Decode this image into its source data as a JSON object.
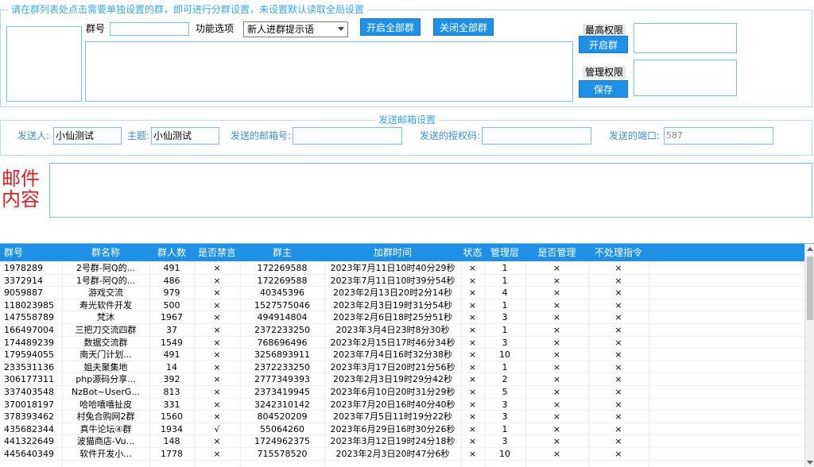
{
  "group_settings": {
    "legend": "请在群列表处点击需要单独设置的群，即可进行分群设置，未设置默认读取全局设置",
    "group_no_label": "群号",
    "group_no_value": "",
    "function_label": "功能选项",
    "function_selected": "新人进群提示语",
    "open_all_label": "开启全部群",
    "close_all_label": "关闭全部群",
    "top_perm_label": "最高权限",
    "open_group_label": "开启群",
    "admin_perm_label": "管理权限",
    "save_label": "保存"
  },
  "mail_settings": {
    "legend": "发送邮箱设置",
    "sender_label": "发送人:",
    "sender_value": "小仙测试",
    "subject_label": "主题:",
    "subject_value": "小仙测试",
    "email_label": "发送的邮箱号:",
    "email_value": "",
    "auth_label": "发送的授权码:",
    "auth_value": "",
    "port_label": "发送的端口:",
    "port_value": "587",
    "content_title_line1": "邮件",
    "content_title_line2": "内容"
  },
  "table": {
    "columns": [
      "群号",
      "群名称",
      "群人数",
      "是否禁言",
      "群主",
      "加群时间",
      "状态",
      "管理层",
      "是否管理",
      "不处理指令"
    ],
    "rows": [
      [
        "1978289",
        "2号群-阿Q的...",
        "491",
        "×",
        "172269588",
        "2023年7月11日10时40分29秒",
        "×",
        "1",
        "×",
        "×"
      ],
      [
        "3372914",
        "1号群-阿Q的...",
        "486",
        "×",
        "172269588",
        "2023年7月11日10时39分54秒",
        "×",
        "1",
        "×",
        "×"
      ],
      [
        "9059887",
        "游戏交流",
        "979",
        "×",
        "40345396",
        "2023年2月13日20时2分14秒",
        "×",
        "4",
        "×",
        "×"
      ],
      [
        "118023985",
        "寿光软件开发",
        "500",
        "×",
        "1527575046",
        "2023年2月3日19时31分54秒",
        "×",
        "1",
        "×",
        "×"
      ],
      [
        "147558789",
        "梵沐",
        "1967",
        "×",
        "494914804",
        "2023年2月6日18时25分51秒",
        "×",
        "3",
        "×",
        "×"
      ],
      [
        "166497004",
        "三把刀交流四群",
        "37",
        "×",
        "2372233250",
        "2023年3月4日23时8分30秒",
        "×",
        "1",
        "×",
        "×"
      ],
      [
        "174489239",
        "数据交流群",
        "1549",
        "×",
        "768696496",
        "2023年2月15日17时46分34秒",
        "×",
        "3",
        "×",
        "×"
      ],
      [
        "179594055",
        "南天门计划...",
        "491",
        "×",
        "3256893911",
        "2023年7月4日16时32分38秒",
        "×",
        "10",
        "×",
        "×"
      ],
      [
        "233531136",
        "姐夫聚集地",
        "14",
        "×",
        "2372233250",
        "2023年3月17日20时21分56秒",
        "×",
        "1",
        "×",
        "×"
      ],
      [
        "306177311",
        "php源码分享...",
        "392",
        "×",
        "2777349393",
        "2023年2月3日19时29分42秒",
        "×",
        "2",
        "×",
        "×"
      ],
      [
        "337403548",
        "NzBot~UserG...",
        "813",
        "×",
        "2373419945",
        "2023年6月10日20时31分29秒",
        "×",
        "5",
        "×",
        "×"
      ],
      [
        "370018197",
        "哈哈嘻嘻扯皮",
        "331",
        "×",
        "3242310142",
        "2023年7月20日16时40分40秒",
        "×",
        "3",
        "×",
        "×"
      ],
      [
        "378393462",
        "村兔合购网2群",
        "1560",
        "×",
        "804520209",
        "2023年7月5日11时19分22秒",
        "×",
        "3",
        "×",
        "×"
      ],
      [
        "435682344",
        "真牛论坛④群",
        "1934",
        "√",
        "55064260",
        "2023年6月29日16时30分26秒",
        "×",
        "1",
        "×",
        "×"
      ],
      [
        "441322649",
        "波猫商店-Vu...",
        "148",
        "×",
        "1724962375",
        "2023年3月12日19时24分18秒",
        "×",
        "3",
        "×",
        "×"
      ],
      [
        "445640349",
        "软件开发小...",
        "1778",
        "×",
        "715578520",
        "2023年2月3日20时47分6秒",
        "×",
        "10",
        "×",
        "×"
      ]
    ]
  },
  "colors": {
    "accent": "#1e90e6",
    "mail_title": "#e02020",
    "legend": "#3aa6e0"
  }
}
